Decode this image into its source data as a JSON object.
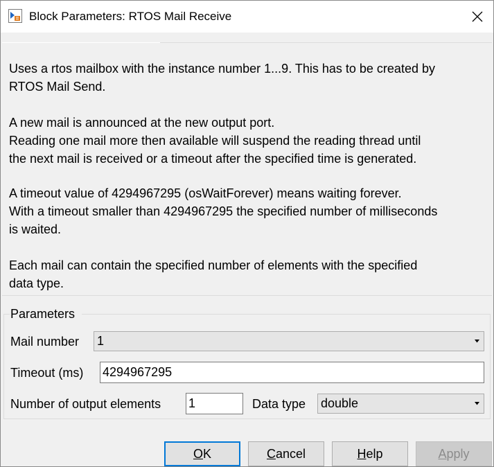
{
  "window": {
    "title": "Block Parameters: RTOS Mail Receive",
    "app_icon": "simulink-block-icon",
    "close_icon": "close-icon"
  },
  "description": {
    "paragraphs": [
      [
        "Uses a rtos mailbox with the instance number 1...9. This has to be created by",
        "RTOS Mail Send."
      ],
      [
        "A new mail is announced at the new output port.",
        "Reading one mail more then available will suspend the reading thread until",
        "the next mail is received or a timeout after the specified time is generated."
      ],
      [
        "A timeout value of 4294967295 (osWaitForever) means waiting forever.",
        "With a timeout smaller than 4294967295 the specified number of milliseconds",
        "is waited."
      ],
      [
        "Each mail can contain the specified number of elements with the specified",
        "data type."
      ]
    ]
  },
  "parameters": {
    "legend": "Parameters",
    "mail_number_label": "Mail number",
    "mail_number_value": "1",
    "timeout_label": "Timeout (ms)",
    "timeout_value": "4294967295",
    "num_elements_label": "Number of output elements",
    "num_elements_value": "1",
    "data_type_label": "Data type",
    "data_type_value": "double"
  },
  "buttons": {
    "ok": {
      "mnemonic": "O",
      "rest": "K"
    },
    "cancel": {
      "mnemonic": "C",
      "rest": "ancel"
    },
    "help": {
      "mnemonic": "H",
      "rest": "elp"
    },
    "apply": {
      "mnemonic": "A",
      "rest": "pply"
    }
  },
  "colors": {
    "accent": "#0078d7",
    "window_bg": "#f0f0f0",
    "titlebar_bg": "#ffffff"
  }
}
